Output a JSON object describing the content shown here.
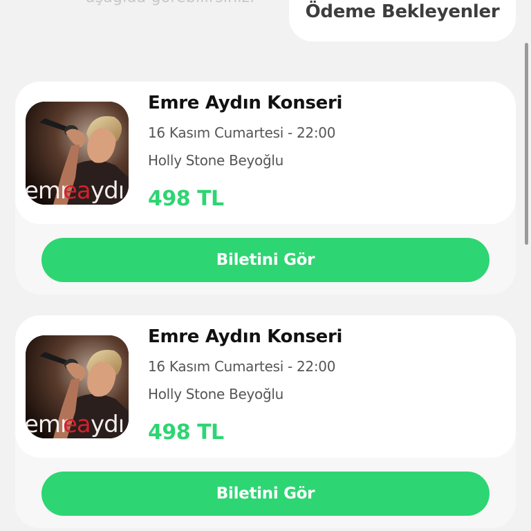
{
  "header": {
    "subtitle_fragment": "aşağıda görebilirsiniz.",
    "pending_tab_label": "Ödeme Bekleyenler"
  },
  "tickets": [
    {
      "title": "Emre Aydın Konseri",
      "date": "16 Kasım Cumartesi - 22:00",
      "venue": "Holly Stone Beyoğlu",
      "price": "498 TL",
      "image_logo_text": "emreaydın",
      "button_label": "Biletini Gör"
    },
    {
      "title": "Emre Aydın Konseri",
      "date": "16 Kasım Cumartesi - 22:00",
      "venue": "Holly Stone Beyoğlu",
      "price": "498 TL",
      "image_logo_text": "emreaydın",
      "button_label": "Biletini Gör"
    }
  ],
  "colors": {
    "accent": "#2ed573",
    "background": "#f2f2f2",
    "card": "#ffffff",
    "title_text": "#111111",
    "secondary_text": "#555555"
  },
  "icons": {
    "event_image": "concert-singer-photo"
  }
}
